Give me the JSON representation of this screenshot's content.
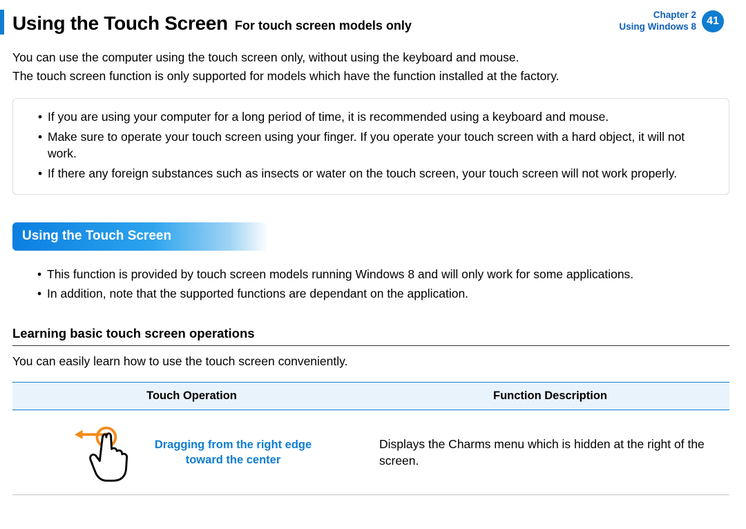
{
  "header": {
    "title_main": "Using the Touch Screen",
    "title_sub": "For touch screen models only",
    "chapter_line1": "Chapter 2",
    "chapter_line2": "Using Windows 8",
    "page_number": "41"
  },
  "intro": {
    "p1": "You can use the computer using the touch screen only, without using the keyboard and mouse.",
    "p2": "The touch screen function is only supported for models which have the function installed at the factory."
  },
  "notebox": {
    "items": [
      "If you are using your computer for a long period of time, it is recommended using a keyboard and mouse.",
      "Make sure to operate your touch screen using your finger. If you operate your touch screen with a hard object, it will not work.",
      "If there any foreign substances such as insects or water on the touch screen, your touch screen will not work properly."
    ]
  },
  "section": {
    "heading": "Using the Touch Screen",
    "bullets": [
      "This function is provided by touch screen models running Windows 8 and will only work for some applications.",
      "In addition, note that the supported functions are dependant on the application."
    ]
  },
  "subsection": {
    "heading": "Learning basic touch screen operations",
    "desc": "You can easily learn how to use the touch screen conveniently."
  },
  "table": {
    "columns": [
      "Touch Operation",
      "Function Description"
    ],
    "rows": [
      {
        "op_label_l1": "Dragging from the right edge",
        "op_label_l2": "toward the center",
        "desc": "Displays the Charms menu which is hidden at the right of the screen."
      }
    ]
  }
}
